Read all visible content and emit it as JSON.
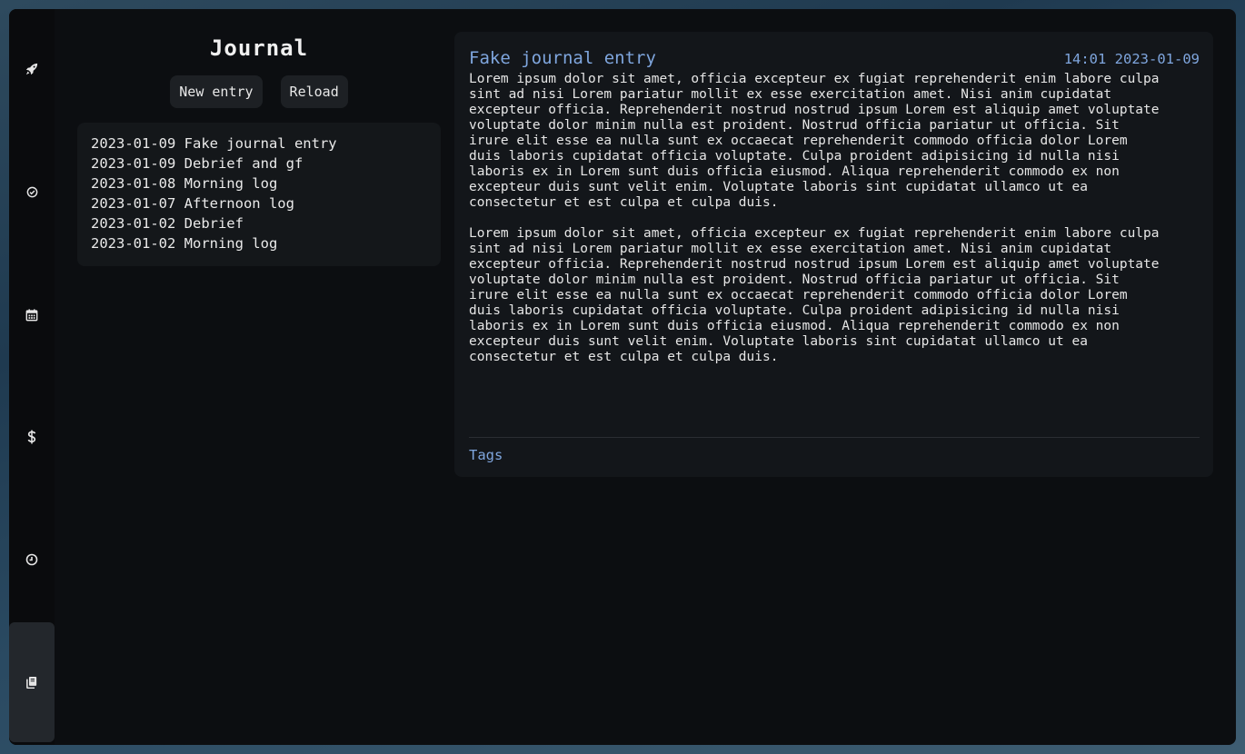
{
  "sidebar": {
    "items": [
      {
        "icon": "rocket-icon",
        "active": false
      },
      {
        "icon": "check-circle-icon",
        "active": false
      },
      {
        "icon": "calendar-icon",
        "active": false
      },
      {
        "icon": "dollar-icon",
        "active": false
      },
      {
        "icon": "clock-icon",
        "active": false
      },
      {
        "icon": "journal-icon",
        "active": true
      }
    ]
  },
  "journal": {
    "title": "Journal",
    "new_entry_label": "New entry",
    "reload_label": "Reload",
    "entries": [
      "2023-01-09 Fake journal entry",
      "2023-01-09 Debrief and gf",
      "2023-01-08 Morning log",
      "2023-01-07 Afternoon log",
      "2023-01-02 Debrief",
      "2023-01-02 Morning log"
    ]
  },
  "entry": {
    "title": "Fake journal entry",
    "timestamp": "14:01 2023-01-09",
    "paragraphs": [
      "Lorem ipsum dolor sit amet, officia excepteur ex fugiat reprehenderit enim labore culpa sint ad nisi Lorem pariatur mollit ex esse exercitation amet. Nisi anim cupidatat excepteur officia. Reprehenderit nostrud nostrud ipsum Lorem est aliquip amet voluptate voluptate dolor minim nulla est proident. Nostrud officia pariatur ut officia. Sit irure elit esse ea nulla sunt ex occaecat reprehenderit commodo officia dolor Lorem duis laboris cupidatat officia voluptate. Culpa proident adipisicing id nulla nisi laboris ex in Lorem sunt duis officia eiusmod. Aliqua reprehenderit commodo ex non excepteur duis sunt velit enim. Voluptate laboris sint cupidatat ullamco ut ea consectetur et est culpa et culpa duis.",
      "Lorem ipsum dolor sit amet, officia excepteur ex fugiat reprehenderit enim labore culpa sint ad nisi Lorem pariatur mollit ex esse exercitation amet. Nisi anim cupidatat excepteur officia. Reprehenderit nostrud nostrud ipsum Lorem est aliquip amet voluptate voluptate dolor minim nulla est proident. Nostrud officia pariatur ut officia. Sit irure elit esse ea nulla sunt ex occaecat reprehenderit commodo officia dolor Lorem duis laboris cupidatat officia voluptate. Culpa proident adipisicing id nulla nisi laboris ex in Lorem sunt duis officia eiusmod. Aliqua reprehenderit commodo ex non excepteur duis sunt velit enim. Voluptate laboris sint cupidatat ullamco ut ea consectetur et est culpa et culpa duis."
    ],
    "tags_label": "Tags"
  },
  "colors": {
    "accent": "#7fa6de",
    "app_background": "#0c0e11",
    "panel_background": "#13161a",
    "button_background": "#1d2024",
    "active_nav_background": "#23272c"
  }
}
